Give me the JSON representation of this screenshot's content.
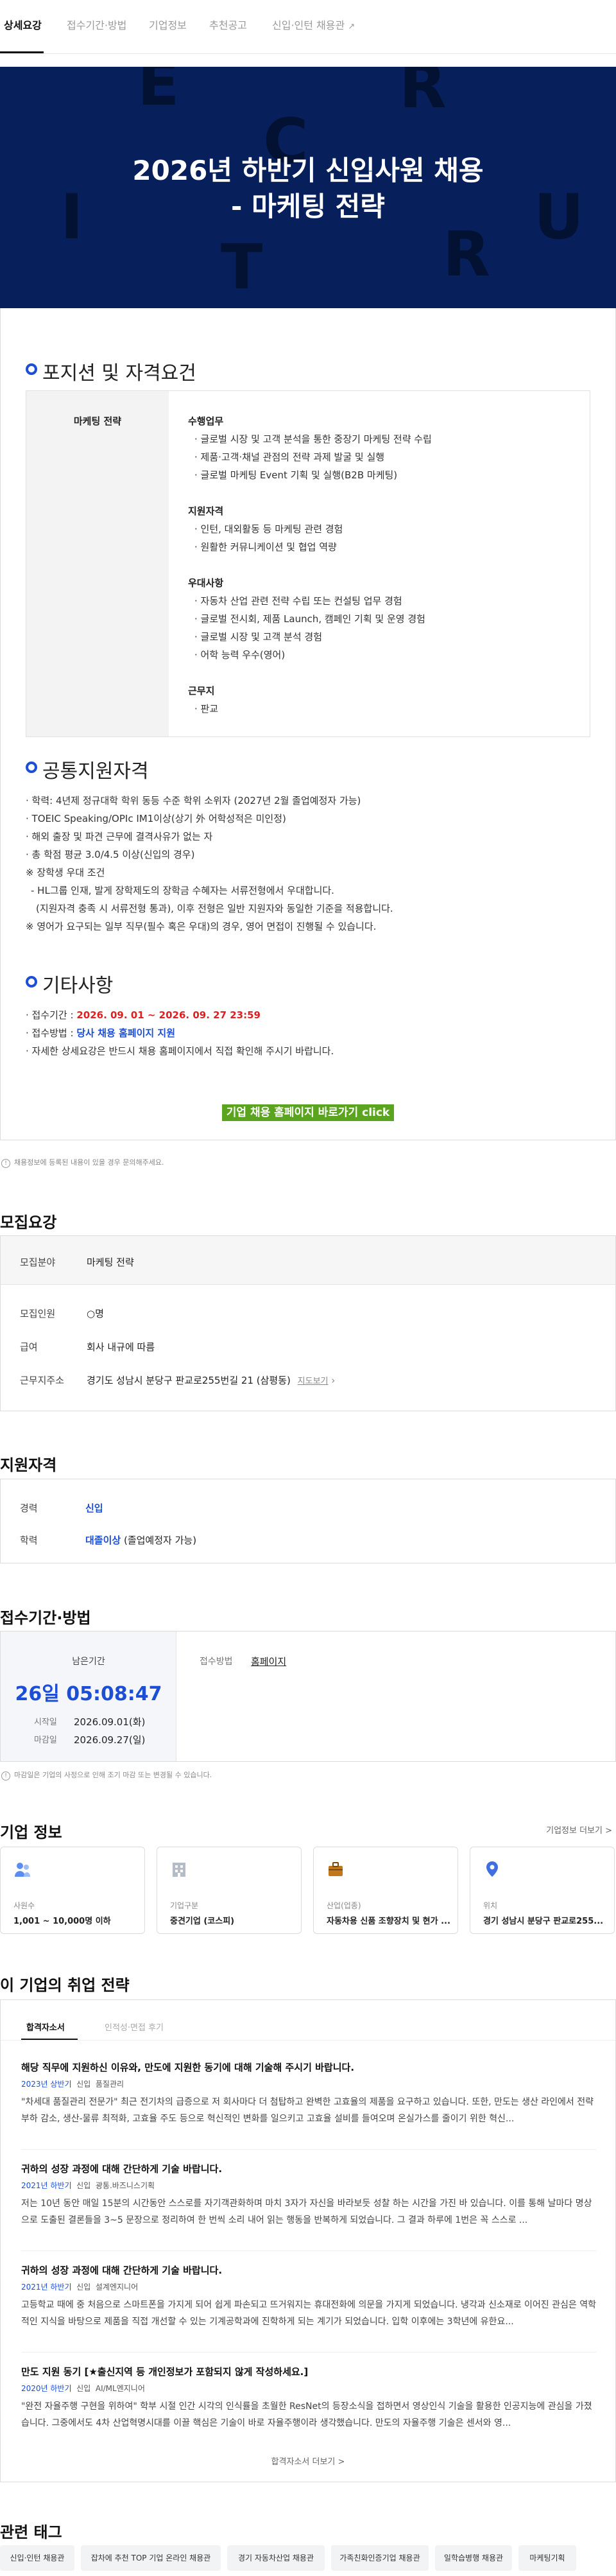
{
  "tabs": [
    "상세요강",
    "접수기간·방법",
    "기업정보",
    "추천공고",
    "신입·인턴 채용관"
  ],
  "hero": {
    "title_line1": "2026년 하반기 신입사원 채용",
    "title_line2": "- 마케팅 전략",
    "letters": [
      "E",
      "R",
      "C",
      "I",
      "U",
      "T",
      "R"
    ]
  },
  "sections": {
    "position": "포지션 및 자격요건",
    "common": "공통지원자격",
    "etc": "기타사항"
  },
  "requirements": {
    "role": "마케팅 전략",
    "groups": [
      {
        "title": "수행업무",
        "items": [
          "글로벌 시장 및 고객 분석을 통한 중장기 마케팅 전략 수립",
          "제품·고객·채널 관점의 전략 과제 발굴 및 실행",
          "글로벌 마케팅 Event 기획 및 실행(B2B 마케팅)"
        ]
      },
      {
        "title": "지원자격",
        "items": [
          "인턴, 대외활동 등 마케팅 관련 경험",
          "원활한 커뮤니케이션 및 협업 역량"
        ]
      },
      {
        "title": "우대사항",
        "items": [
          "자동차 산업 관련 전략 수립 또는 컨설팅 업무 경험",
          "글로벌 전시회, 제품 Launch, 캠페인 기획 및 운영 경험",
          "글로벌 시장 및 고객 분석 경험",
          "어학 능력 우수(영어)"
        ]
      },
      {
        "title": "근무지",
        "items": [
          "판교"
        ]
      }
    ]
  },
  "common_items": [
    "· 학력: 4년제 정규대학 학위 동등 수준 학위 소위자 (2027년 2월 졸업예정자 가능)",
    "· TOEIC Speaking/OPIc IM1이상(상기 外 어학성적은 미인정)",
    "· 해외 출장 및 파견 근무에 결격사유가 없는 자",
    "· 총 학점 평균 3.0/4.5 이상(신입의 경우)",
    "※ 장학생 우대 조건",
    "  - HL그룹 인재, 발게 장학제도의 장학금 수혜자는 서류전형에서 우대합니다.",
    "    (지원자격 충족 시 서류전형 통과), 이후 전형은 일반 지원자와 동일한 기준을 적용합니다.",
    "※ 영어가 요구되는 일부 직무(필수 혹은 우대)의 경우, 영어 면접이 진행될 수 있습니다."
  ],
  "etc_items": {
    "period_label": "· 접수기간 : ",
    "period_value": "2026. 09. 01 ~ 2026. 09. 27  23:59",
    "method_label": "· 접수방법 : ",
    "method_value": "당사 채용 홈페이지 지원",
    "detail": "· 자세한 상세요강은 반드시 채용 홈페이지에서 직접 확인해 주시기 바랍니다."
  },
  "apply_button": "기업 채용 홈페이지 바로가기 click",
  "note_posting": "채용정보에 등록된 내용이 있을 경우 문의해주세요.",
  "summary": {
    "heading": "모집요강",
    "rows": [
      {
        "label": "모집분야",
        "value": "마케팅 전략"
      },
      {
        "label": "모집인원",
        "value": "○명"
      },
      {
        "label": "급여",
        "value": "회사 내규에 따름"
      },
      {
        "label": "근무지주소",
        "value": "경기도 성남시 분당구 판교로255번길 21 (삼평동)"
      }
    ],
    "map_link": "지도보기"
  },
  "qualification": {
    "heading": "지원자격",
    "rows": [
      {
        "label": "경력",
        "value": "신입"
      },
      {
        "label": "학력",
        "value": "대졸이상",
        "extra": " (졸업예정자 가능)"
      }
    ]
  },
  "period": {
    "heading": "접수기간·방법",
    "remaining_label": "남은기간",
    "countdown": "26일 05:08:47",
    "start_label": "시작일",
    "start": "2026.09.01(화)",
    "end_label": "마감일",
    "end": "2026.09.27(일)",
    "method_label": "접수방법",
    "method_value": "홈페이지"
  },
  "note_period": "마감일은 기업의 사정으로 인해 조기 마감 또는 변경될 수 있습니다.",
  "company": {
    "heading": "기업 정보",
    "more": "기업정보 더보기 >",
    "cards": [
      {
        "icon": "people-icon",
        "label": "사원수",
        "value": "1,001 ~ 10,000명 이하"
      },
      {
        "icon": "building-icon",
        "label": "기업구분",
        "value": "중견기업 (코스피)"
      },
      {
        "icon": "briefcase-icon",
        "label": "산업(업종)",
        "value": "자동차용 신품 조향장치 및 현가 ..."
      },
      {
        "icon": "location-icon",
        "label": "위치",
        "value": "경기 성남시 분당구 판교로255..."
      }
    ]
  },
  "strategy": {
    "heading": "이 기업의 취업 전략",
    "tabs": [
      "합격자소서",
      "인적성·면접 후기"
    ],
    "entries": [
      {
        "q": "해당 직무에 지원하신 이유와, 만도에 지원한 동기에 대해 기술해 주시기 바랍니다.",
        "year": "2023년 상반기",
        "type": "신입",
        "dept": "품질관리",
        "a": "\"차세대 품질관리 전문가\" 최근 전기차의 급증으로 저 회사마다 더 첨탑하고 완벽한 고효율의 제품을 요구하고 있습니다. 또한, 만도는 생산 라인에서 전략 부하 감소, 생산-물류 최적화, 고효율 주도 등으로 혁신적인 변화를 일으키고 고효율 설비를 들여오며 온실가스를 줄이기 위한 혁신..."
      },
      {
        "q": "귀하의 성장 과정에 대해 간단하게 기술 바랍니다.",
        "year": "2021년 하반기",
        "type": "신입",
        "dept": "광통.바즈니스기획",
        "a": "저는 10년 동안 매일 15분의 시간동안 스스로를 자기객관화하며 마치 3자가 자신을 바라보듯 성찰 하는 시간을 가진 바 있습니다. 이를 통해 날마다 명상으로 도출된 결론들을 3~5 문장으로 정리하여 한 번씩 소리 내어 읽는 행동을 반복하게 되었습니다. 그 결과 하루에 1번은 꼭 스스로 ..."
      },
      {
        "q": "귀하의 성장 과정에 대해 간단하게 기술 바랍니다.",
        "year": "2021년 하반기",
        "type": "신입",
        "dept": "설계엔지니어",
        "a": "고등학교 때에 중 처음으로 스마트폰을 가지게 되어 쉽게 파손되고 뜨거워지는 휴대전화에 의문을 가지게 되었습니다. 냉각과 신소재로 이어진 관심은 역학적인 지식을 바탕으로 제품을 직접 개선할 수 있는 기계공학과에 진학하게 되는 계기가 되었습니다. 입학 이후에는 3학년에 유한요..."
      },
      {
        "q": "만도 지원 동기 [★출신지역 등 개인정보가 포함되지 않게 작성하세요.]",
        "year": "2020년 하반기",
        "type": "신입",
        "dept": "AI/ML엔지니어",
        "a": "\"완전 자율주행 구현을 위하여\" 학부 시절 인간 시각의 인식률을 초월한 ResNet의 등장소식을 접하면서 영상인식 기술을 활용한 인공지능에 관심을 가졌습니다. 그중에서도 4차 산업혁명시대를 이끌 핵심은 기술이 바로 자율주행이라 생각했습니다. 만도의 자율주행 기술은 센서와 영..."
      }
    ],
    "more": "합격자소서 더보기 >"
  },
  "tags": {
    "heading": "관련 태그",
    "items": [
      "신입·인턴 채용관",
      "잡차에 추천 TOP 기업 온라인 채용관",
      "경기 자동차산업 채용관",
      "가족친화인증기업 채용관",
      "일학습병행 채용관",
      "마케팅기획"
    ]
  },
  "colors": {
    "accent": "#1c4fd6",
    "hero_bg": "#07205b",
    "deadline_red": "#e02020",
    "button_green": "#5aa41f"
  }
}
